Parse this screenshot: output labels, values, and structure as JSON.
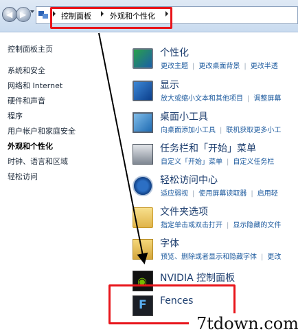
{
  "address_bar": {
    "crumbs": [
      "控制面板",
      "外观和个性化"
    ]
  },
  "left_nav": {
    "items": [
      {
        "label": "控制面板主页"
      },
      {
        "label": "系统和安全"
      },
      {
        "label": "网络和 Internet"
      },
      {
        "label": "硬件和声音"
      },
      {
        "label": "程序"
      },
      {
        "label": "用户帐户和家庭安全"
      },
      {
        "label": "外观和个性化",
        "current": true
      },
      {
        "label": "时钟、语言和区域"
      },
      {
        "label": "轻松访问"
      }
    ]
  },
  "categories": [
    {
      "title": "个性化",
      "icon": "personalization-icon",
      "links": [
        "更改主题",
        "更改桌面背景",
        "更改半透"
      ]
    },
    {
      "title": "显示",
      "icon": "display-icon",
      "links": [
        "放大或缩小文本和其他项目",
        "调整屏幕"
      ]
    },
    {
      "title": "桌面小工具",
      "icon": "desktop-gadgets-icon",
      "links": [
        "向桌面添加小工具",
        "联机获取更多小工"
      ]
    },
    {
      "title": "任务栏和「开始」菜单",
      "icon": "taskbar-icon",
      "links": [
        "自定义「开始」菜单",
        "自定义任务栏"
      ]
    },
    {
      "title": "轻松访问中心",
      "icon": "ease-of-access-icon",
      "links": [
        "适应弱视",
        "使用屏幕读取器",
        "启用轻"
      ]
    },
    {
      "title": "文件夹选项",
      "icon": "folder-options-icon",
      "links": [
        "指定单击或双击打开",
        "显示隐藏的文件"
      ]
    },
    {
      "title": "字体",
      "icon": "fonts-icon",
      "links": [
        "预览、删除或者显示和隐藏字体",
        "更改"
      ]
    },
    {
      "title": "NVIDIA 控制面板",
      "icon": "nvidia-icon",
      "links": []
    },
    {
      "title": "Fences",
      "icon": "fences-icon",
      "links": []
    }
  ],
  "watermark": "7tdown.com",
  "colors": {
    "highlight": "#e8141a",
    "link": "#1c5a9e",
    "title": "#1c3d6e"
  }
}
